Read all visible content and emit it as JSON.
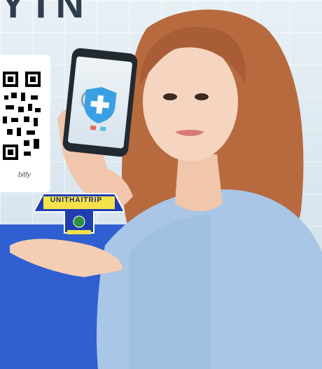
{
  "headline": "YTN",
  "qr": {
    "caption": "bitly"
  },
  "logo": {
    "text": "UNITHAITRIP"
  },
  "icons": {
    "app": "medical-shield-icon"
  },
  "colors": {
    "accent_blue": "#2f5fd1",
    "logo_yellow": "#f4e24a",
    "logo_blue": "#1f3fb0"
  }
}
